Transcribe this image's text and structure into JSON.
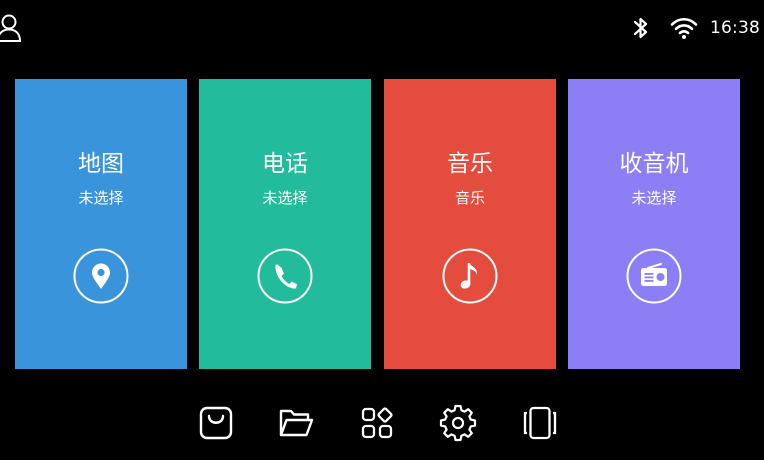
{
  "status_bar": {
    "time": "16:38",
    "icons": [
      "user-icon",
      "bluetooth-icon",
      "wifi-icon"
    ]
  },
  "cards": [
    {
      "title": "地图",
      "subtitle": "未选择",
      "icon": "map-pin-icon",
      "color": "#3a94dc"
    },
    {
      "title": "电话",
      "subtitle": "未选择",
      "icon": "phone-icon",
      "color": "#22bc9c"
    },
    {
      "title": "音乐",
      "subtitle": "音乐",
      "icon": "music-note-icon",
      "color": "#e44d3e"
    },
    {
      "title": "收音机",
      "subtitle": "未选择",
      "icon": "radio-icon",
      "color": "#8c7ff5"
    }
  ],
  "dock": {
    "icons": [
      "bag-icon",
      "folder-icon",
      "apps-grid-icon",
      "settings-gear-icon",
      "multiscreen-icon"
    ]
  }
}
